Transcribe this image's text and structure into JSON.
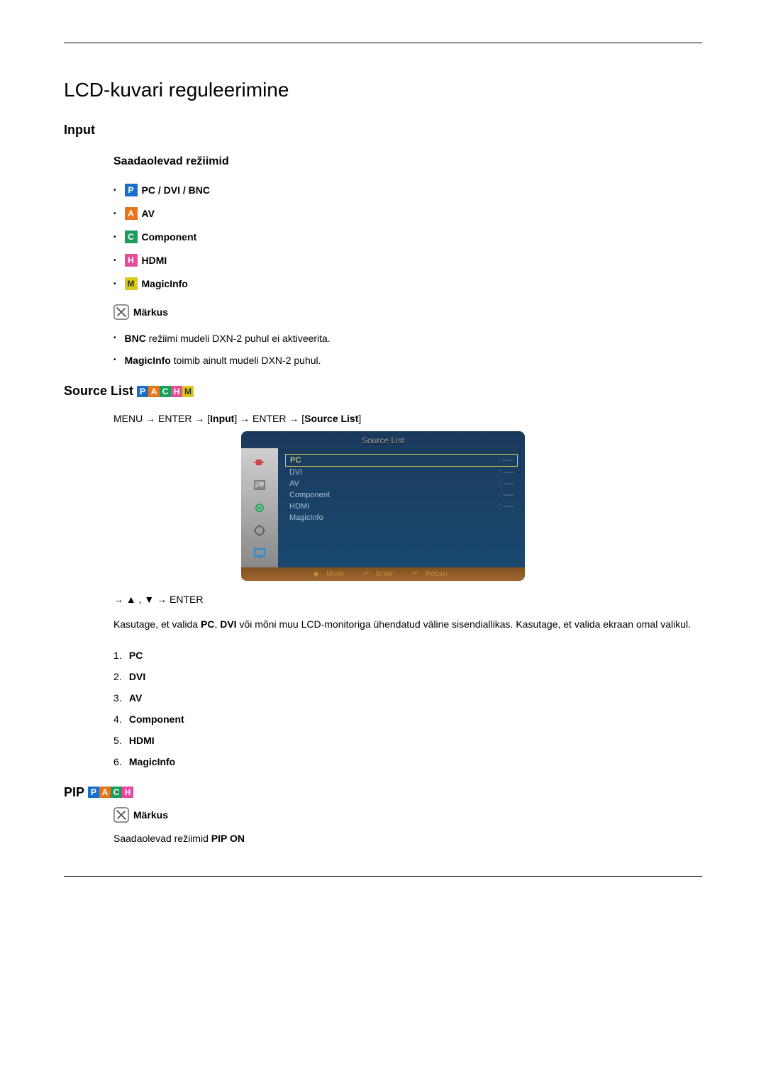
{
  "page_title": "LCD-kuvari reguleerimine",
  "input": {
    "heading": "Input",
    "modes_heading": "Saadaolevad režiimid",
    "modes": [
      {
        "badge": "P",
        "label": "PC / DVI / BNC"
      },
      {
        "badge": "A",
        "label": "AV"
      },
      {
        "badge": "C",
        "label": "Component"
      },
      {
        "badge": "H",
        "label": "HDMI"
      },
      {
        "badge": "M",
        "label": "MagicInfo"
      }
    ],
    "note_label": "Märkus",
    "notes": [
      {
        "prefix": "BNC",
        "rest": " režiimi mudeli DXN-2 puhul ei aktiveerita."
      },
      {
        "prefix": "MagicInfo",
        "rest": " toimib ainult mudeli DXN-2 puhul."
      }
    ]
  },
  "source_list": {
    "heading": "Source List",
    "menu_path": {
      "p1": "MENU → ENTER → [",
      "p2": "Input",
      "p3": "] → ENTER → [",
      "p4": "Source List",
      "p5": "]"
    },
    "osd": {
      "title": "Source List",
      "items": [
        "PC",
        "DVI",
        "AV",
        "Component",
        "HDMI",
        "MagicInfo"
      ],
      "selected_index": 0,
      "footer": {
        "move": "Move",
        "enter": "Enter",
        "return": "Return"
      }
    },
    "nav_path": "→ ▲ , ▼ → ENTER",
    "paragraph": {
      "p1": "Kasutage, et valida ",
      "p2": "PC",
      "p3": ", ",
      "p4": "DVI",
      "p5": " või mõni muu LCD-monitoriga ühendatud väline sisendiallikas. Kasutage, et valida ekraan omal valikul."
    },
    "num_list": [
      "PC",
      "DVI",
      "AV",
      "Component",
      "HDMI",
      "MagicInfo"
    ]
  },
  "pip": {
    "heading": "PIP",
    "note_label": "Märkus",
    "text_prefix": "Saadaolevad režiimid ",
    "text_bold": "PIP ON"
  }
}
